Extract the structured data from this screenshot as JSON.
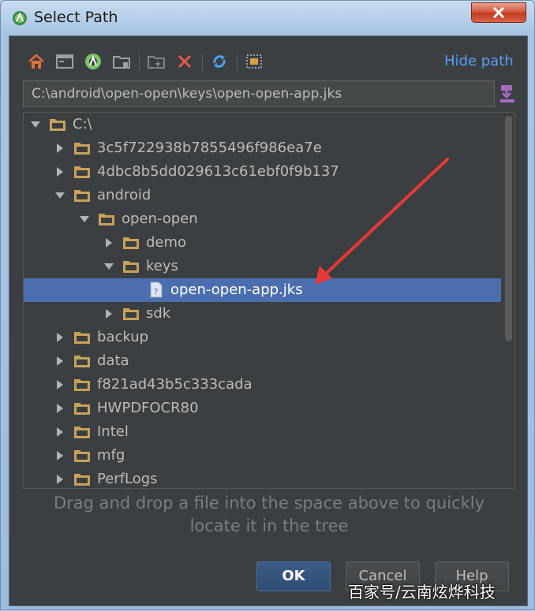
{
  "window": {
    "title": "Select Path"
  },
  "toolbar": {
    "icons": [
      "home-icon",
      "desktop-icon",
      "android-icon",
      "folder-project-icon",
      "new-folder-icon",
      "delete-icon",
      "refresh-icon",
      "show-hidden-icon"
    ],
    "hide_path_label": "Hide path"
  },
  "path_field": {
    "value": "C:\\android\\open-open\\keys\\open-open-app.jks"
  },
  "tree": {
    "items": [
      {
        "label": "C:\\",
        "depth": 0,
        "expanded": true,
        "type": "drive"
      },
      {
        "label": "3c5f722938b7855496f986ea7e",
        "depth": 1,
        "expanded": false,
        "type": "folder"
      },
      {
        "label": "4dbc8b5dd029613c61ebf0f9b137",
        "depth": 1,
        "expanded": false,
        "type": "folder"
      },
      {
        "label": "android",
        "depth": 1,
        "expanded": true,
        "type": "folder"
      },
      {
        "label": "open-open",
        "depth": 2,
        "expanded": true,
        "type": "folder"
      },
      {
        "label": "demo",
        "depth": 3,
        "expanded": false,
        "type": "folder"
      },
      {
        "label": "keys",
        "depth": 3,
        "expanded": true,
        "type": "folder"
      },
      {
        "label": "open-open-app.jks",
        "depth": 4,
        "expanded": null,
        "type": "file",
        "selected": true
      },
      {
        "label": "sdk",
        "depth": 3,
        "expanded": false,
        "type": "folder"
      },
      {
        "label": "backup",
        "depth": 1,
        "expanded": false,
        "type": "folder"
      },
      {
        "label": "data",
        "depth": 1,
        "expanded": false,
        "type": "folder"
      },
      {
        "label": "f821ad43b5c333cada",
        "depth": 1,
        "expanded": false,
        "type": "folder"
      },
      {
        "label": "HWPDFOCR80",
        "depth": 1,
        "expanded": false,
        "type": "folder"
      },
      {
        "label": "Intel",
        "depth": 1,
        "expanded": false,
        "type": "folder"
      },
      {
        "label": "mfg",
        "depth": 1,
        "expanded": false,
        "type": "folder"
      },
      {
        "label": "PerfLogs",
        "depth": 1,
        "expanded": false,
        "type": "folder"
      }
    ]
  },
  "hint": {
    "line1": "Drag and drop a file into the space above to quickly",
    "line2": "locate it in the tree"
  },
  "buttons": {
    "ok": "OK",
    "cancel": "Cancel",
    "help": "Help"
  },
  "watermark": "百家号/云南炫烨科技",
  "colors": {
    "background": "#3c3f41",
    "selection": "#4b6eaf",
    "link": "#589df6",
    "folder": "#c9a15a",
    "annotation_arrow": "#e53935"
  }
}
